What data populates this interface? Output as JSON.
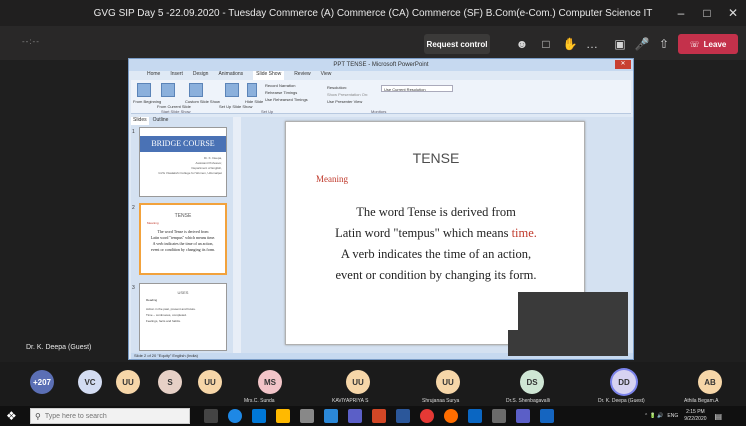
{
  "meeting": {
    "title": "GVG SIP Day 5 -22.09.2020 - Tuesday Commerce (A) Commerce (CA) Commerce (SF) B.Com(e-Com.) Computer Science IT",
    "timer": "--:--",
    "request_control_label": "Request control",
    "leave_label": "Leave"
  },
  "presenter": {
    "name": "Dr. K. Deepa (Guest)"
  },
  "powerpoint": {
    "window_title": "PPT TENSE - Microsoft PowerPoint",
    "tabs": [
      "Home",
      "Insert",
      "Design",
      "Animations",
      "Slide Show",
      "Review",
      "View"
    ],
    "active_tab": "Slide Show",
    "ribbon": {
      "buttons": [
        "From Beginning",
        "From Current Slide",
        "Custom Slide Show",
        "Set Up Slide Show",
        "Hide Slide"
      ],
      "options": [
        "Record Narration",
        "Rehearse Timings",
        "Use Rehearsed Timings"
      ],
      "resolution_label": "Resolution:",
      "resolution_value": "Use Current Resolution",
      "show_on_label": "Show Presentation On:",
      "presenter_view_label": "Use Presenter View",
      "groups": [
        "Start Slide Show",
        "Set Up",
        "Monitors"
      ]
    },
    "pane_tabs": [
      "Slides",
      "Outline"
    ],
    "thumbnails": [
      {
        "number": "1",
        "title": "BRIDGE COURSE",
        "lines": [
          "Dr. K. Deepa,",
          "Assistant Professor,",
          "Department of English,",
          "GVG Visalakshi College for Women, Udumalpet"
        ]
      },
      {
        "number": "2",
        "title": "TENSE",
        "subtitle": "Meaning",
        "lines": [
          "The word Tense is derived from",
          "Latin word \"tempus\" which means time.",
          "A verb indicates the time of an action,",
          "event or condition by changing its form."
        ]
      },
      {
        "number": "3",
        "title": "USES",
        "subtitle": "Reading",
        "lines": [
          "Action in the past, present and future.",
          "Time – continuous, completed.",
          "Feelings, facts and habits."
        ]
      }
    ],
    "status_bar": "Slide 2 of 20    \"Equity\"    English (India)",
    "slide": {
      "title": "TENSE",
      "subtitle": "Meaning",
      "line1": "The word Tense is derived from",
      "line2_prefix": "Latin word \"tempus\" which means ",
      "line2_highlight": "time.",
      "line3": "A verb indicates the time of an action,",
      "line4": "event or condition by changing its form."
    }
  },
  "participants": [
    {
      "initials": "+207",
      "name": "",
      "color": "#5b6fb5"
    },
    {
      "initials": "VC",
      "name": "",
      "color": "#d3dcf2"
    },
    {
      "initials": "UU",
      "name": "",
      "color": "#f6d6a8"
    },
    {
      "initials": "S",
      "name": "",
      "color": "#e6d0c6"
    },
    {
      "initials": "UU",
      "name": "",
      "color": "#f6d6a8"
    },
    {
      "initials": "MS",
      "name": "Mrs.C. Sunda",
      "color": "#f2c4c8"
    },
    {
      "initials": "UU",
      "name": "KAVIYAPRIYA S",
      "color": "#f6d6a8"
    },
    {
      "initials": "UU",
      "name": "Shrujanaa Surya",
      "color": "#f6d6a8"
    },
    {
      "initials": "DS",
      "name": "Dr.S. Shenbagavalli",
      "color": "#cfe6d4"
    },
    {
      "initials": "DD",
      "name": "Dr. K. Deepa (Guest)",
      "color": "#d7d3f1"
    },
    {
      "initials": "AB",
      "name": "Athila Begam.A",
      "color": "#f6d6a8"
    }
  ],
  "taskbar": {
    "search_placeholder": "Type here to search",
    "language": "ENG",
    "time": "2:15 PM",
    "date": "9/22/2020"
  }
}
